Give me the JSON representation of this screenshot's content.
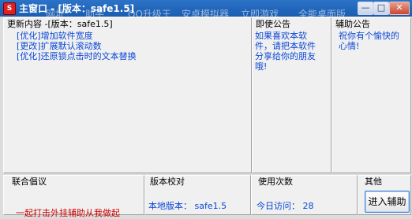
{
  "window": {
    "title": "主窗口 - [版本：safe1.5]",
    "icon": "app-icon",
    "controls": {
      "minimize": "—",
      "maximize": "□",
      "close": "✕"
    }
  },
  "background_menu": [
    "网址",
    "助手",
    "QQ升级王",
    "安卓模拟器",
    "立即游戏",
    "全能桌面版"
  ],
  "panels": {
    "update": {
      "title": "更新内容 -[版本：safe1.5]",
      "items": [
        "[优化]增加软件宽度",
        "[更改]扩展默认滚动数",
        "[优化]还原锁点击时的文本替换"
      ]
    },
    "ad_notice": {
      "title": "即使公告",
      "text_lines": [
        "如果喜欢本软",
        "件，请把本软件",
        "分享给你的朋友",
        "哦!"
      ]
    },
    "aux_notice": {
      "title": "辅助公告",
      "text_lines": [
        "祝你有个愉快的",
        "心情!"
      ]
    },
    "alliance": {
      "title": "联合倡议",
      "text": "一起打击外挂辅助从我做起"
    },
    "version": {
      "title": "版本校对",
      "local_label": "本地版本：",
      "local_value": "safe1.5"
    },
    "usage": {
      "title": "使用次数",
      "today_label": "今日访问：",
      "today_value": "28"
    },
    "other": {
      "title": "其他",
      "button": "进入辅助"
    }
  },
  "colors": {
    "titlebar": "#1a5cb0",
    "text_blue": "#0b47d6",
    "text_red": "#cc0000",
    "panel_bg": "#f0f0f0"
  }
}
